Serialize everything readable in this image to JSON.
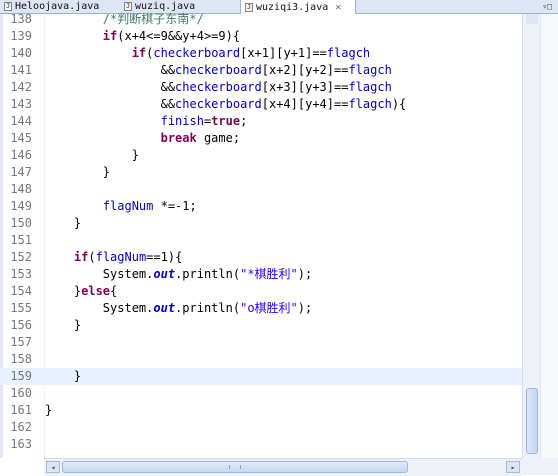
{
  "tabs": [
    {
      "label": "Heloojava.java",
      "active": false,
      "closable": false
    },
    {
      "label": "wuziq.java",
      "active": false,
      "closable": false
    },
    {
      "label": "wuziqi3.java",
      "active": true,
      "closable": true
    }
  ],
  "close_glyph": "✕",
  "window_controls": "▿□",
  "colors": {
    "keyword": "#7f0055",
    "variable": "#0000c0",
    "string": "#2a00ff",
    "comment": "#3f7f5f",
    "line_number": "#787878",
    "current_line": "#e8f2fe"
  },
  "current_line_number": "159",
  "lines": [
    {
      "number": "138",
      "tokens": [
        {
          "t": "        /*判断棋子东南*/",
          "c": "cmt"
        }
      ]
    },
    {
      "number": "139",
      "tokens": [
        {
          "t": "        "
        },
        {
          "t": "if",
          "c": "kw"
        },
        {
          "t": "(x+4<=9&&y+4>=9){"
        }
      ]
    },
    {
      "number": "140",
      "tokens": [
        {
          "t": "            "
        },
        {
          "t": "if",
          "c": "kw"
        },
        {
          "t": "("
        },
        {
          "t": "checkerboard",
          "c": "var"
        },
        {
          "t": "[x+1][y+1]=="
        },
        {
          "t": "flagch",
          "c": "var"
        }
      ]
    },
    {
      "number": "141",
      "tokens": [
        {
          "t": "                &&"
        },
        {
          "t": "checkerboard",
          "c": "var"
        },
        {
          "t": "[x+2][y+2]=="
        },
        {
          "t": "flagch",
          "c": "var"
        }
      ]
    },
    {
      "number": "142",
      "tokens": [
        {
          "t": "                &&"
        },
        {
          "t": "checkerboard",
          "c": "var"
        },
        {
          "t": "[x+3][y+3]=="
        },
        {
          "t": "flagch",
          "c": "var"
        }
      ]
    },
    {
      "number": "143",
      "tokens": [
        {
          "t": "                &&"
        },
        {
          "t": "checkerboard",
          "c": "var"
        },
        {
          "t": "[x+4][y+4]=="
        },
        {
          "t": "flagch",
          "c": "var"
        },
        {
          "t": "){"
        }
      ]
    },
    {
      "number": "144",
      "tokens": [
        {
          "t": "                "
        },
        {
          "t": "finish",
          "c": "var"
        },
        {
          "t": "="
        },
        {
          "t": "true",
          "c": "kw"
        },
        {
          "t": ";"
        }
      ]
    },
    {
      "number": "145",
      "tokens": [
        {
          "t": "                "
        },
        {
          "t": "break",
          "c": "kw"
        },
        {
          "t": " game;"
        }
      ]
    },
    {
      "number": "146",
      "tokens": [
        {
          "t": "            }"
        }
      ]
    },
    {
      "number": "147",
      "tokens": [
        {
          "t": "        }"
        }
      ]
    },
    {
      "number": "148",
      "tokens": []
    },
    {
      "number": "149",
      "tokens": [
        {
          "t": "        "
        },
        {
          "t": "flagNum",
          "c": "var"
        },
        {
          "t": " *=-1;"
        }
      ]
    },
    {
      "number": "150",
      "tokens": [
        {
          "t": "    }"
        }
      ]
    },
    {
      "number": "151",
      "tokens": []
    },
    {
      "number": "152",
      "tokens": [
        {
          "t": "    "
        },
        {
          "t": "if",
          "c": "kw"
        },
        {
          "t": "("
        },
        {
          "t": "flagNum",
          "c": "var"
        },
        {
          "t": "==1){"
        }
      ]
    },
    {
      "number": "153",
      "tokens": [
        {
          "t": "        System."
        },
        {
          "t": "out",
          "c": "fld"
        },
        {
          "t": ".println("
        },
        {
          "t": "\"*棋胜利\"",
          "c": "str"
        },
        {
          "t": ");"
        }
      ]
    },
    {
      "number": "154",
      "tokens": [
        {
          "t": "    }"
        },
        {
          "t": "else",
          "c": "kw"
        },
        {
          "t": "{"
        }
      ]
    },
    {
      "number": "155",
      "tokens": [
        {
          "t": "        System."
        },
        {
          "t": "out",
          "c": "fld"
        },
        {
          "t": ".println("
        },
        {
          "t": "\"o棋胜利\"",
          "c": "str"
        },
        {
          "t": ");"
        }
      ]
    },
    {
      "number": "156",
      "tokens": [
        {
          "t": "    }"
        }
      ]
    },
    {
      "number": "157",
      "tokens": []
    },
    {
      "number": "158",
      "tokens": []
    },
    {
      "number": "159",
      "tokens": [
        {
          "t": "    }"
        }
      ]
    },
    {
      "number": "160",
      "tokens": []
    },
    {
      "number": "161",
      "tokens": [
        {
          "t": "}"
        }
      ]
    },
    {
      "number": "162",
      "tokens": []
    },
    {
      "number": "163",
      "tokens": []
    }
  ],
  "scroll": {
    "vertical_position": 0.86,
    "horizontal_thumb_fraction": 0.73
  }
}
